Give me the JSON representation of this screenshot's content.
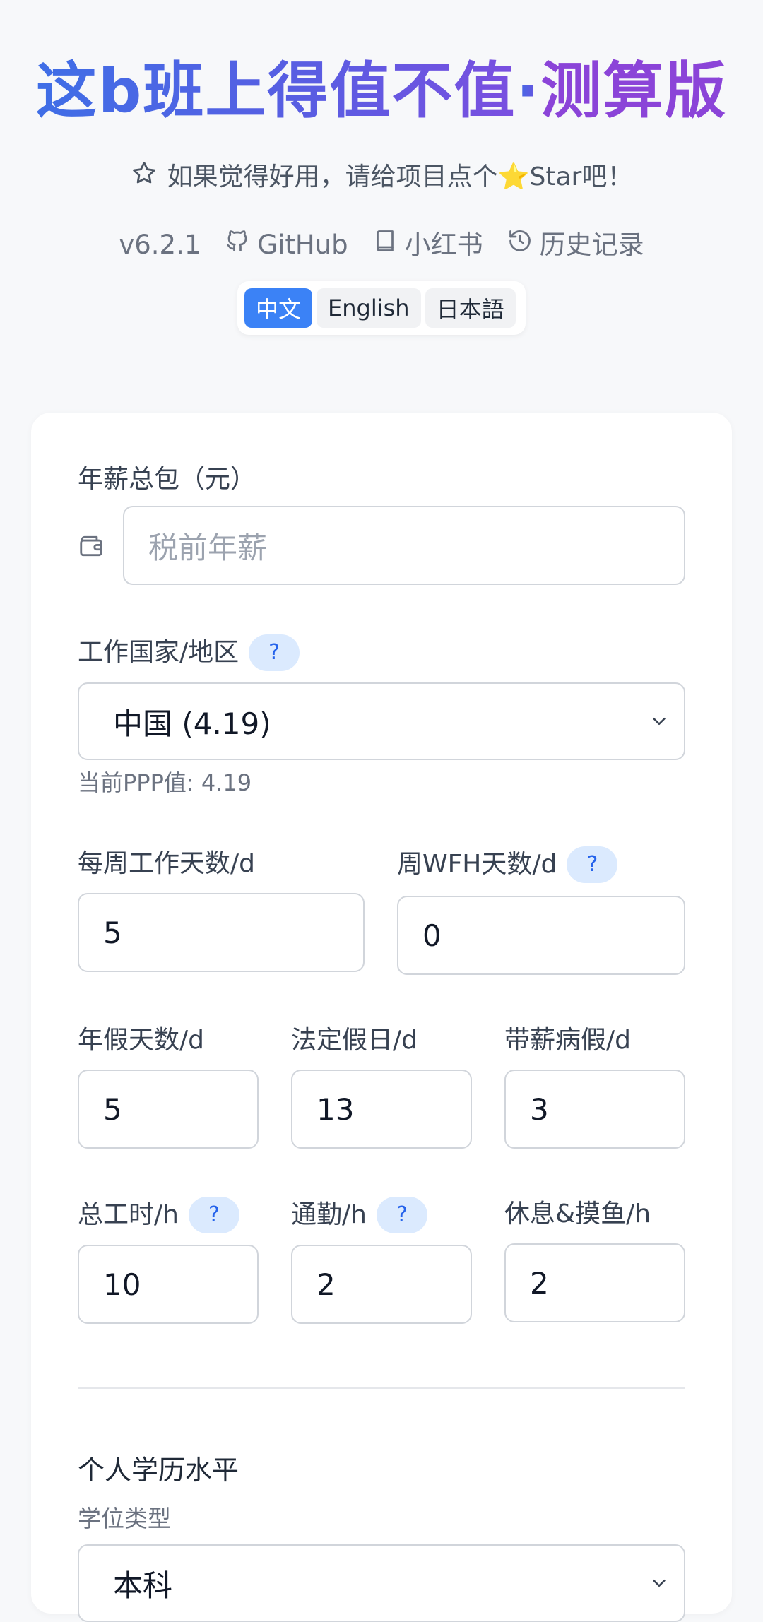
{
  "header": {
    "title_main": "这b班上得值不值",
    "title_sep": "·",
    "title_sub": "测算版",
    "subtitle": "如果觉得好用，请给项目点个⭐Star吧！",
    "links": {
      "version": "v6.2.1",
      "github": "GitHub",
      "xiaohongshu": "小红书",
      "history": "历史记录"
    },
    "languages": [
      "中文",
      "English",
      "日本語"
    ],
    "active_language": "中文"
  },
  "form": {
    "salary": {
      "label": "年薪总包（元）",
      "placeholder": "税前年薪",
      "value": ""
    },
    "country": {
      "label": "工作国家/地区",
      "help": "?",
      "value": "中国 (4.19)",
      "ppp_hint": "当前PPP值: 4.19"
    },
    "work_days": {
      "label": "每周工作天数/d",
      "value": "5"
    },
    "wfh_days": {
      "label": "周WFH天数/d",
      "help": "?",
      "value": "0"
    },
    "annual_leave": {
      "label": "年假天数/d",
      "value": "5"
    },
    "holidays": {
      "label": "法定假日/d",
      "value": "13"
    },
    "sick_leave": {
      "label": "带薪病假/d",
      "value": "3"
    },
    "total_hours": {
      "label": "总工时/h",
      "help": "?",
      "value": "10"
    },
    "commute": {
      "label": "通勤/h",
      "help": "?",
      "value": "2"
    },
    "rest": {
      "label": "休息&摸鱼/h",
      "value": "2"
    },
    "education": {
      "section_title": "个人学历水平",
      "degree_label": "学位类型",
      "degree_value": "本科"
    }
  },
  "colors": {
    "accent": "#3b82f6",
    "title_blue": "#3f6ee6",
    "title_purple": "#8b44d8",
    "help_bg": "#dbeafe"
  }
}
